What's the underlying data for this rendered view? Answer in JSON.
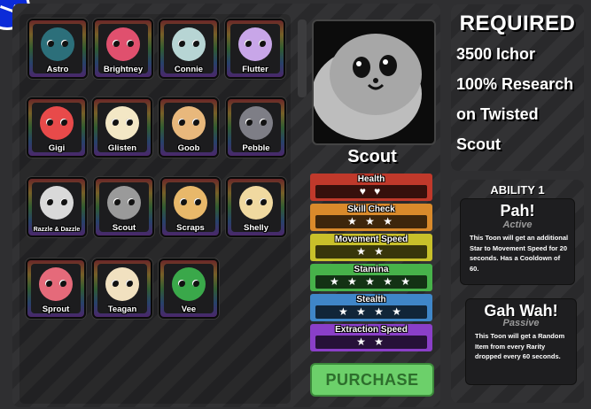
{
  "toons": [
    {
      "name": "Astro",
      "color": "#2c6f7a"
    },
    {
      "name": "Brightney",
      "color": "#e0506e"
    },
    {
      "name": "Connie",
      "color": "#b7d5d4"
    },
    {
      "name": "Flutter",
      "color": "#c8a6e8"
    },
    {
      "name": "Gigi",
      "color": "#e84a4a"
    },
    {
      "name": "Glisten",
      "color": "#f3e7c5"
    },
    {
      "name": "Goob",
      "color": "#e8b87c"
    },
    {
      "name": "Pebble",
      "color": "#7e7e86"
    },
    {
      "name": "Razzle & Dazzle",
      "color": "#d9d9d9"
    },
    {
      "name": "Scout",
      "color": "#9a9a9a"
    },
    {
      "name": "Scraps",
      "color": "#e8b86a"
    },
    {
      "name": "Shelly",
      "color": "#f0d9a0"
    },
    {
      "name": "Sprout",
      "color": "#e56a7a"
    },
    {
      "name": "Teagan",
      "color": "#f1e1c0"
    },
    {
      "name": "Vee",
      "color": "#3aa84a"
    }
  ],
  "selected": {
    "name": "Scout",
    "stats": [
      {
        "label": "Health",
        "value": "♥ ♥",
        "color": "#c0392b"
      },
      {
        "label": "Skill Check",
        "value": "★ ★ ★",
        "color": "#d98a2b"
      },
      {
        "label": "Movement Speed",
        "value": "★ ★",
        "color": "#c8c02a"
      },
      {
        "label": "Stamina",
        "value": "★ ★ ★ ★ ★",
        "color": "#47b24a"
      },
      {
        "label": "Stealth",
        "value": "★ ★ ★ ★",
        "color": "#3f86c8"
      },
      {
        "label": "Extraction Speed",
        "value": "★ ★",
        "color": "#8a3fc8"
      }
    ]
  },
  "purchase_label": "PURCHASE",
  "required": {
    "title": "REQUIRED",
    "lines": [
      "3500 Ichor",
      "100% Research",
      "on Twisted",
      "Scout"
    ]
  },
  "ability": {
    "title": "ABILITY 1",
    "active": {
      "name": "Pah!",
      "type": "Active",
      "desc": "This Toon will get an additional Star to Movement Speed for 20 seconds. Has a Cooldown of 60."
    },
    "passive": {
      "name": "Gah Wah!",
      "type": "Passive",
      "desc": "This Toon will get a Random Item from every Rarity dropped every 60 seconds."
    }
  }
}
